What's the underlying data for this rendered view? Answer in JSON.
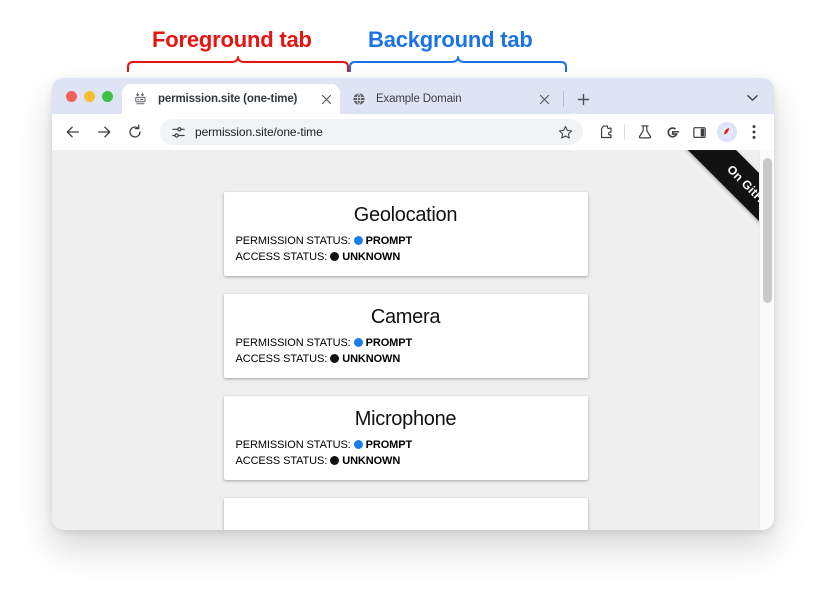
{
  "annotations": {
    "foreground_label": "Foreground tab",
    "background_label": "Background tab",
    "foreground_color": "#e8140f",
    "background_color": "#1a73e8"
  },
  "browser": {
    "tabs": [
      {
        "title": "permission.site (one-time)",
        "favicon": "permission-site-favicon",
        "active": true,
        "close_glyph": "✕"
      },
      {
        "title": "Example Domain",
        "favicon": "globe-icon",
        "active": false,
        "close_glyph": "✕"
      }
    ],
    "new_tab_glyph": "+",
    "tab_list_glyph": "⌄",
    "toolbar": {
      "back_glyph": "←",
      "forward_glyph": "→",
      "reload_glyph": "↻",
      "site_settings_icon": "tune-sliders-icon",
      "url": "permission.site/one-time",
      "bookmark_glyph": "☆",
      "extensions_icon": "puzzle-piece-icon",
      "labs_icon": "flask-icon",
      "google_icon": "google-g-icon",
      "side_panel_icon": "side-panel-icon",
      "profile_icon": "profile-avatar-icon",
      "menu_glyph": "⋮"
    }
  },
  "page": {
    "ribbon_label": "On GitHub",
    "background_color": "#efefef",
    "cards": [
      {
        "title": "Geolocation",
        "rows": [
          {
            "label": "PERMISSION STATUS:",
            "dot_color": "#1a7de8",
            "value": "PROMPT"
          },
          {
            "label": "ACCESS STATUS:",
            "dot_color": "#121212",
            "value": "UNKNOWN"
          }
        ]
      },
      {
        "title": "Camera",
        "rows": [
          {
            "label": "PERMISSION STATUS:",
            "dot_color": "#1a7de8",
            "value": "PROMPT"
          },
          {
            "label": "ACCESS STATUS:",
            "dot_color": "#121212",
            "value": "UNKNOWN"
          }
        ]
      },
      {
        "title": "Microphone",
        "rows": [
          {
            "label": "PERMISSION STATUS:",
            "dot_color": "#1a7de8",
            "value": "PROMPT"
          },
          {
            "label": "ACCESS STATUS:",
            "dot_color": "#121212",
            "value": "UNKNOWN"
          }
        ]
      }
    ]
  }
}
